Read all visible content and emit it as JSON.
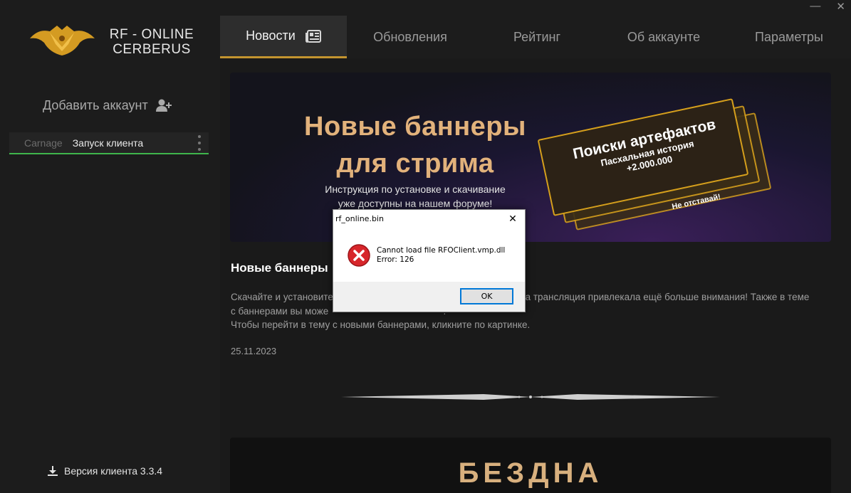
{
  "app": {
    "logo_line1": "RF - ONLINE",
    "logo_line2": "CERBERUS",
    "window_controls": {
      "minimize": "—",
      "close": "✕"
    }
  },
  "sidebar": {
    "add_account_label": "Добавить аккаунт",
    "accounts": [
      {
        "name": "Carnage",
        "status": "Запуск клиента"
      }
    ],
    "version_label": "Версия клиента 3.3.4"
  },
  "nav": {
    "tabs": [
      {
        "label": "Новости",
        "active": true
      },
      {
        "label": "Обновления"
      },
      {
        "label": "Рейтинг"
      },
      {
        "label": "Об аккаунте"
      },
      {
        "label": "Параметры"
      }
    ]
  },
  "news": {
    "banner": {
      "title_line1": "Новые баннеры",
      "title_line2": "для стрима",
      "subtitle_line1": "Инструкция по установке и скачивание",
      "subtitle_line2": "уже доступны на нашем форуме!",
      "card_line1": "Поиски артефактов",
      "card_line2": "Пасхальная история",
      "card_line3": "+2.000.000",
      "card_tail": "Не отставай!"
    },
    "title": "Новые баннеры",
    "body_line1": "Скачайте и установите                                                                   аша трансляция привлекала ещё больше внимания! Также в теме",
    "body_line2": "с баннерами вы може                                           .",
    "body_line3": "Чтобы перейти в тему с новыми баннерами, кликните по картинке.",
    "date": "25.11.2023",
    "next_banner_title": "БЕЗДНА"
  },
  "dialog": {
    "title": "rf_online.bin",
    "message_line1": "Cannot load file RFOClient.vmp.dll",
    "message_line2": "Error: 126",
    "ok_label": "OK"
  },
  "colors": {
    "accent_gold": "#c3942f",
    "account_underline": "#3fb54b",
    "error_red": "#d7262b"
  }
}
